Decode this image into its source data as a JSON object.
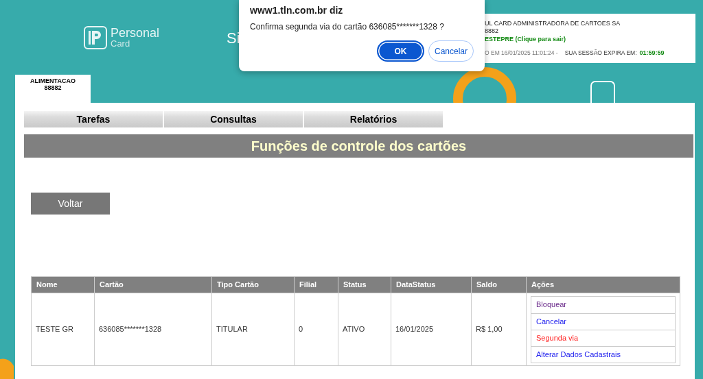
{
  "header": {
    "logo": {
      "name": "Personal",
      "subname": "Card"
    },
    "system_title": "Si",
    "tab": {
      "label": "ALIMENTACAO",
      "code": "88882"
    },
    "session": {
      "company": "UL CARD ADMINISTRADORA DE CARTOES SA",
      "code": "8882",
      "user": "ESTEPRE (Clique para sair)",
      "access": "O EM 16/01/2025 11:01:24 -",
      "expires_label": "SUA SESSÃO EXPIRA EM:",
      "expires_time": "01:59:59"
    }
  },
  "menu": [
    {
      "label": "Tarefas"
    },
    {
      "label": "Consultas"
    },
    {
      "label": "Relatórios"
    }
  ],
  "page_title": "Funções de controle dos cartões",
  "back_button": "Voltar",
  "table": {
    "columns": [
      "Nome",
      "Cartão",
      "Tipo Cartão",
      "Filial",
      "Status",
      "DataStatus",
      "Saldo",
      "Ações"
    ],
    "rows": [
      {
        "cells": [
          "TESTE GR",
          "636085*******1328",
          "TITULAR",
          "0",
          "ATIVO",
          "16/01/2025",
          "R$ 1,00"
        ],
        "actions": [
          {
            "label": "Bloquear",
            "color": "#6a2a8a"
          },
          {
            "label": "Cancelar",
            "color": "#2020ee"
          },
          {
            "label": "Segunda via",
            "color": "#ff2020"
          },
          {
            "label": "Alterar Dados Cadastrais",
            "color": "#2020ee"
          }
        ]
      }
    ]
  },
  "dialog": {
    "title": "www1.tln.com.br diz",
    "message": "Confirma segunda via do cartão 636085*******1328 ?",
    "buttons": [
      {
        "label": "OK",
        "kind": "primary"
      },
      {
        "label": "Cancelar",
        "kind": "secondary"
      }
    ]
  }
}
